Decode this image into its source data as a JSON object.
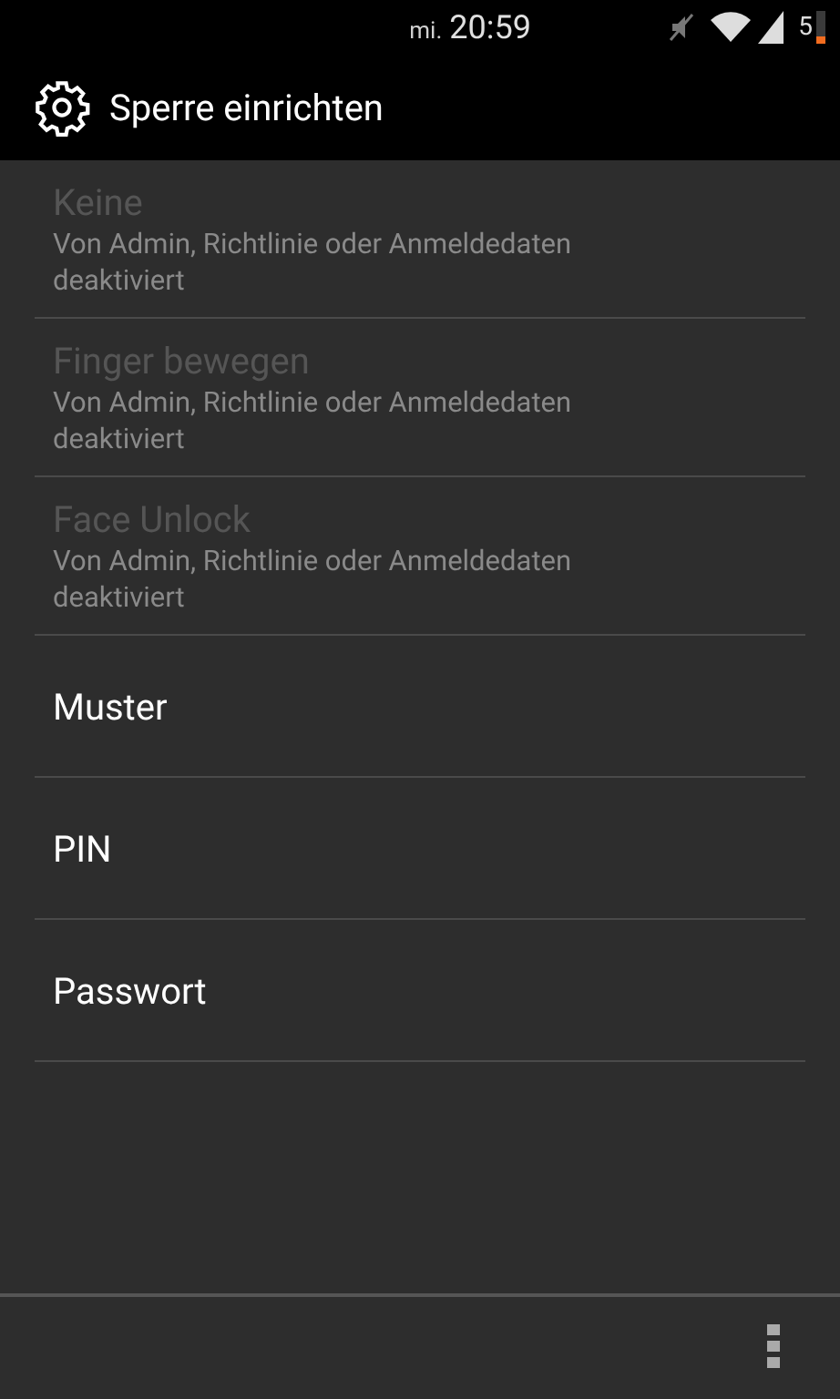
{
  "status_bar": {
    "day": "mi.",
    "time": "20:59",
    "battery": "5"
  },
  "action_bar": {
    "title": "Sperre einrichten"
  },
  "items": [
    {
      "title": "Keine",
      "summary": "Von Admin, Richtlinie oder Anmeldedaten deaktiviert",
      "disabled": true
    },
    {
      "title": "Finger bewegen",
      "summary": "Von Admin, Richtlinie oder Anmeldedaten deaktiviert",
      "disabled": true
    },
    {
      "title": "Face Unlock",
      "summary": "Von Admin, Richtlinie oder Anmeldedaten deaktiviert",
      "disabled": true
    },
    {
      "title": "Muster",
      "disabled": false
    },
    {
      "title": "PIN",
      "disabled": false
    },
    {
      "title": "Passwort",
      "disabled": false
    }
  ]
}
